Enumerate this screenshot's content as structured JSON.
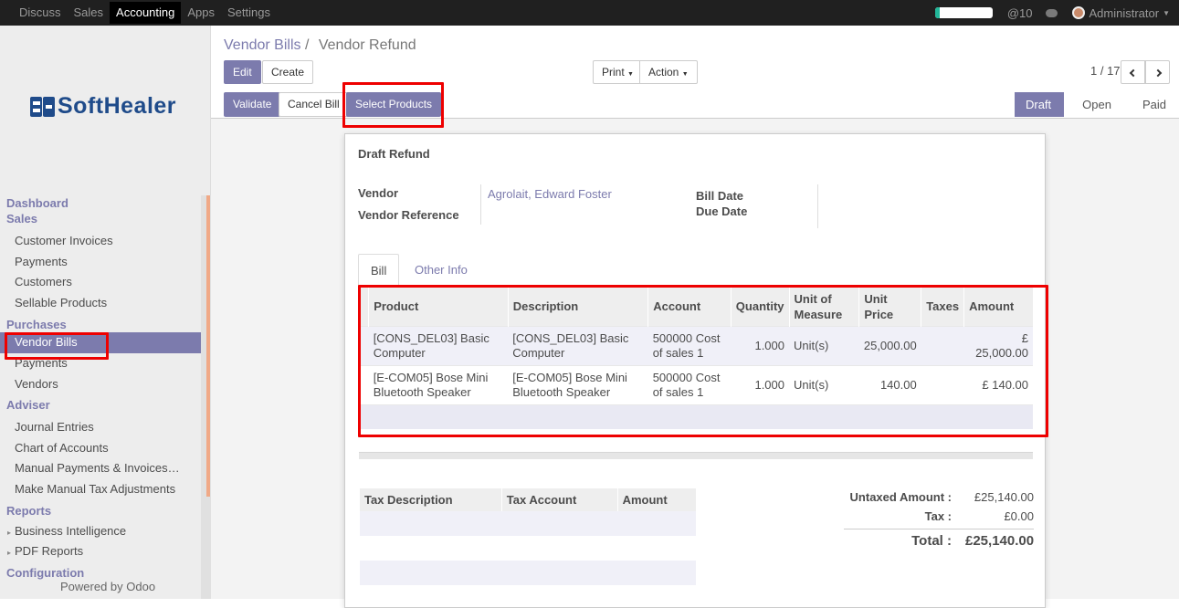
{
  "topbar": {
    "menu": [
      "Discuss",
      "Sales",
      "Accounting",
      "Apps",
      "Settings"
    ],
    "active_menu": "Accounting",
    "mentions": "@10",
    "user": "Administrator",
    "progress_fraction": 0.08,
    "progress_color": "#21b799"
  },
  "logo": {
    "text": "SoftHealer",
    "brand_color": "#1f4b8a"
  },
  "sidebar": {
    "sections": [
      {
        "title": "Dashboard",
        "items": []
      },
      {
        "title": "Sales",
        "items": [
          "Customer Invoices",
          "Payments",
          "Customers",
          "Sellable Products"
        ]
      },
      {
        "title": "Purchases",
        "items": [
          "Vendor Bills",
          "Payments",
          "Vendors"
        ]
      },
      {
        "title": "Adviser",
        "items": [
          "Journal Entries",
          "Chart of Accounts",
          "Manual Payments & Invoices…",
          "Make Manual Tax Adjustments"
        ]
      },
      {
        "title": "Reports",
        "items": [
          "Business Intelligence",
          "PDF Reports"
        ]
      },
      {
        "title": "Configuration",
        "items": []
      }
    ],
    "active_item": "Vendor Bills",
    "footer": "Powered by Odoo"
  },
  "breadcrumb": {
    "parent": "Vendor Bills",
    "separator": "/",
    "current": "Vendor Refund"
  },
  "buttons": {
    "edit": "Edit",
    "create": "Create",
    "print": "Print",
    "action": "Action",
    "pager": "1 / 17",
    "validate": "Validate",
    "cancel_bill": "Cancel Bill",
    "select_products": "Select Products"
  },
  "status_bar": {
    "states": [
      "Draft",
      "Open",
      "Paid"
    ],
    "current": "Draft"
  },
  "accent_color": "#7c7bad",
  "highlight_color": "#e00000",
  "form": {
    "title": "Draft Refund",
    "vendor_label": "Vendor",
    "vendor_value": "Agrolait, Edward Foster",
    "vendor_reference_label": "Vendor Reference",
    "bill_date_label": "Bill Date",
    "due_date_label": "Due Date",
    "tabs": [
      "Bill",
      "Other Info"
    ],
    "active_tab": "Bill",
    "lines_headers": [
      "Product",
      "Description",
      "Account",
      "Quantity",
      "Unit of Measure",
      "Unit Price",
      "Taxes",
      "Amount"
    ],
    "lines": [
      {
        "product": "[CONS_DEL03] Basic Computer",
        "description": "[CONS_DEL03] Basic Computer",
        "account": "500000 Cost of sales 1",
        "quantity": "1.000",
        "uom": "Unit(s)",
        "price": "25,000.00",
        "taxes": "",
        "amount": "£ 25,000.00"
      },
      {
        "product": "[E-COM05] Bose Mini Bluetooth Speaker",
        "description": "[E-COM05] Bose Mini Bluetooth Speaker",
        "account": "500000 Cost of sales 1",
        "quantity": "1.000",
        "uom": "Unit(s)",
        "price": "140.00",
        "taxes": "",
        "amount": "£ 140.00"
      }
    ],
    "tax_headers": [
      "Tax Description",
      "Tax Account",
      "Amount"
    ],
    "untaxed_label": "Untaxed Amount :",
    "untaxed_value": "£25,140.00",
    "tax_label": "Tax :",
    "tax_value": "£0.00",
    "total_label": "Total :",
    "total_value": "£25,140.00"
  }
}
